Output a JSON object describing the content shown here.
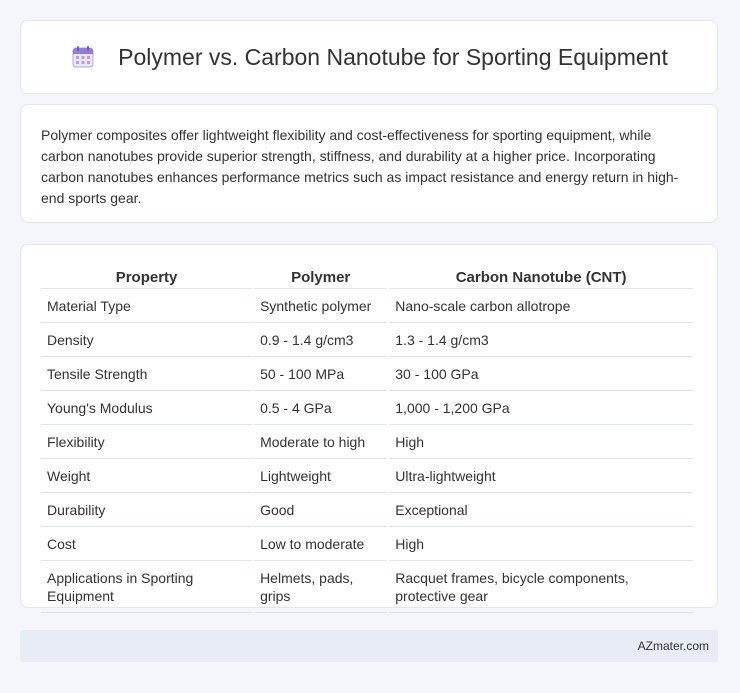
{
  "header": {
    "title": "Polymer vs. Carbon Nanotube for Sporting Equipment",
    "icon": "calendar-icon"
  },
  "intro": {
    "text": "Polymer composites offer lightweight flexibility and cost-effectiveness for sporting equipment, while carbon nanotubes provide superior strength, stiffness, and durability at a higher price. Incorporating carbon nanotubes enhances performance metrics such as impact resistance and energy return in high-end sports gear."
  },
  "table": {
    "headers": [
      "Property",
      "Polymer",
      "Carbon Nanotube (CNT)"
    ],
    "rows": [
      [
        "Material Type",
        "Synthetic polymer",
        "Nano-scale carbon allotrope"
      ],
      [
        "Density",
        "0.9 - 1.4 g/cm3",
        "1.3 - 1.4 g/cm3"
      ],
      [
        "Tensile Strength",
        "50 - 100 MPa",
        "30 - 100 GPa"
      ],
      [
        "Young's Modulus",
        "0.5 - 4 GPa",
        "1,000 - 1,200 GPa"
      ],
      [
        "Flexibility",
        "Moderate to high",
        "High"
      ],
      [
        "Weight",
        "Lightweight",
        "Ultra-lightweight"
      ],
      [
        "Durability",
        "Good",
        "Exceptional"
      ],
      [
        "Cost",
        "Low to moderate",
        "High"
      ],
      [
        "Applications in Sporting Equipment",
        "Helmets, pads, grips",
        "Racquet frames, bicycle components, protective gear"
      ]
    ]
  },
  "footer": {
    "text": "AZmater.com"
  }
}
